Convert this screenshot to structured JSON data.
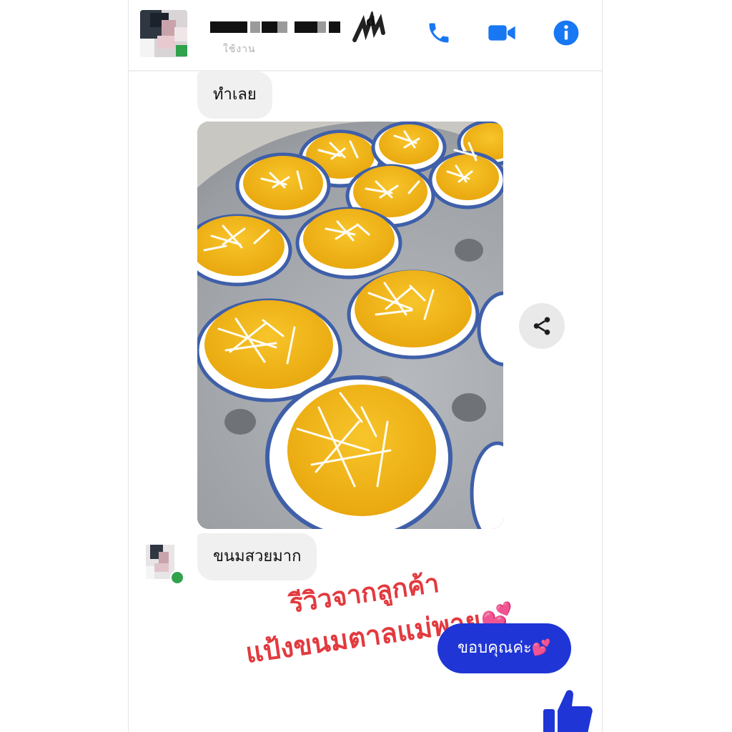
{
  "header": {
    "contact_status": "ใช้งาน",
    "icons": [
      "phone-icon",
      "video-camera-icon",
      "info-icon"
    ],
    "accent_color": "#1877f2"
  },
  "messages": [
    {
      "from": "other",
      "type": "text",
      "text": "ทำเลย"
    },
    {
      "from": "other",
      "type": "photo",
      "subject": "steamed Thai palm cakes topped with shredded coconut"
    },
    {
      "from": "other",
      "type": "text",
      "text": "ขนมสวยมาก"
    },
    {
      "from": "me",
      "type": "text",
      "text": "ขอบคุณค่ะ💕"
    }
  ],
  "overlay": {
    "line_1": "รีวิวจากลูกค้า",
    "line_2": "แป้งขนมตาลแม่พายุ💕",
    "color": "#e23a3f"
  },
  "colors": {
    "incoming_bubble": "#f0f0f0",
    "outgoing_bubble": "#1f35d6",
    "online": "#31a24c",
    "like_icon": "#1f35d6"
  }
}
